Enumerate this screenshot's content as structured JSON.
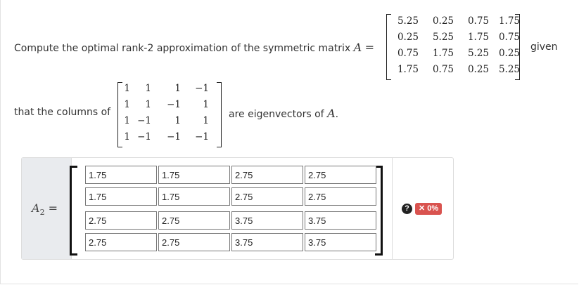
{
  "question": {
    "line1_prefix": "Compute the optimal rank-2 approximation of the symmetric matrix",
    "matrix_symbol": "A",
    "equals": "=",
    "given_word": "given",
    "line2_prefix": "that the columns of",
    "line2_suffix": "are eigenvectors of",
    "line2_symbol": "A",
    "line2_period": ".",
    "matrix_A": [
      [
        "5.25",
        "0.25",
        "0.75",
        "1.75"
      ],
      [
        "0.25",
        "5.25",
        "1.75",
        "0.75"
      ],
      [
        "0.75",
        "1.75",
        "5.25",
        "0.25"
      ],
      [
        "1.75",
        "0.75",
        "0.25",
        "5.25"
      ]
    ],
    "eigen_matrix": [
      [
        "1",
        "1",
        "1",
        "−1"
      ],
      [
        "1",
        "1",
        "−1",
        "1"
      ],
      [
        "1",
        "−1",
        "1",
        "1"
      ],
      [
        "1",
        "−1",
        "−1",
        "−1"
      ]
    ]
  },
  "answer": {
    "label_symbol": "A",
    "label_subscript": "2",
    "label_equals": "=",
    "inputs": [
      [
        "1.75",
        "1.75",
        "2.75",
        "2.75"
      ],
      [
        "1.75",
        "1.75",
        "2.75",
        "2.75"
      ],
      [
        "2.75",
        "2.75",
        "3.75",
        "3.75"
      ],
      [
        "2.75",
        "2.75",
        "3.75",
        "3.75"
      ]
    ],
    "help_icon": "?",
    "score_badge": "✕ 0%",
    "score_color": "#d9534f"
  }
}
